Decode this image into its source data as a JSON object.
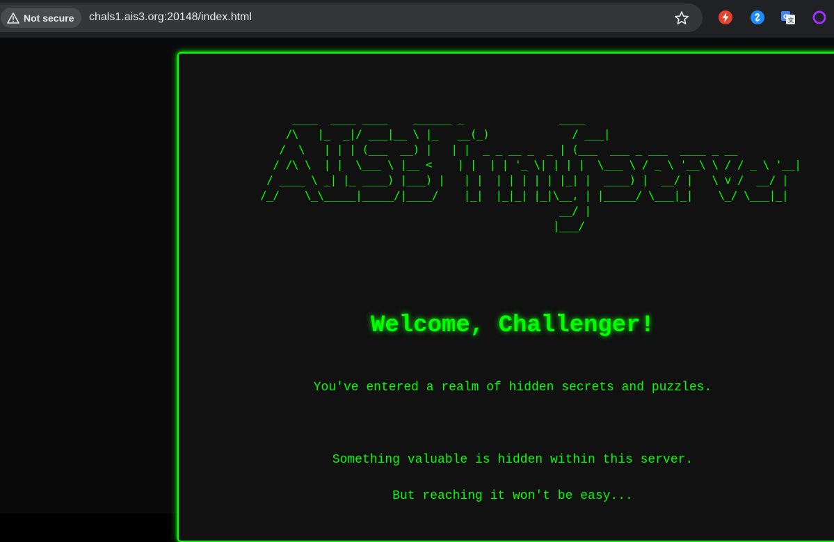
{
  "browser": {
    "security_label": "Not secure",
    "url": "chals1.ais3.org:20148/index.html",
    "star_icon": "star-icon",
    "extensions": [
      "red-lightning-extension-icon",
      "shazam-extension-icon",
      "google-translate-extension-icon",
      "purple-ring-extension-icon"
    ]
  },
  "page": {
    "ascii_art": "     ____  ____ ____    ______ _               ____\n    /\\   |_  _|/ ___|__ \\ |_   __(_)             / ___|\n   /  \\   | | | (___  __) |   | |  _ _ __ _  _ | (___  ___ _ ___  ____ _ __\n  / /\\ \\  | |  \\___ \\ |__ <    | |  | | '_ \\| | | |  \\___ \\ / _ \\ '__\\ \\ / / _ \\ '__|\n / ____ \\ _| |_ ____) |___) |   | |  | | | | | |_| |  ____) |  __/ |   \\ v /  __/ |\n/_/    \\_\\_____|_____/|____/    |_|  |_|_| |_|\\__, | |_____/ \\___|_|    \\_/ \\___|_|\n                                               __/ |\n                                              |___/",
    "welcome": "Welcome, Challenger!",
    "line1": "You've entered a realm of hidden secrets and puzzles.",
    "line2": "Something valuable is hidden within this server.",
    "line3": "But reaching it won't be easy..."
  },
  "colors": {
    "accent": "#00ff00",
    "panel_bg": "#111111"
  }
}
